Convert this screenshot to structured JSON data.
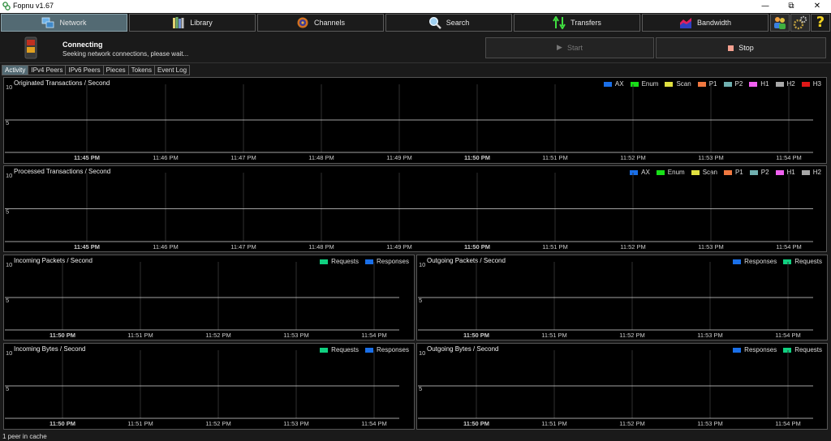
{
  "window": {
    "title": "Fopnu v1.67"
  },
  "tabs": [
    {
      "label": "Network",
      "icon": "network-icon"
    },
    {
      "label": "Library",
      "icon": "library-books-icon"
    },
    {
      "label": "Channels",
      "icon": "channels-icon"
    },
    {
      "label": "Search",
      "icon": "search-icon"
    },
    {
      "label": "Transfers",
      "icon": "transfers-icon"
    },
    {
      "label": "Bandwidth",
      "icon": "bandwidth-icon"
    }
  ],
  "status": {
    "title": "Connecting",
    "message": "Seeking network connections, please wait...",
    "start_label": "Start",
    "stop_label": "Stop"
  },
  "subtabs": [
    "Activity",
    "IPv4 Peers",
    "IPv6 Peers",
    "Pieces",
    "Tokens",
    "Event Log"
  ],
  "colors": {
    "AX": "#1a6fe8",
    "Enum": "#18e018",
    "Scan": "#e0e040",
    "P1": "#f07840",
    "P2": "#70b0b0",
    "H1": "#f060f0",
    "H2": "#a8a8a8",
    "H3": "#e01818",
    "Requests": "#10d080",
    "Responses": "#1a6fe8"
  },
  "charts": [
    {
      "title": "Originated Transactions / Second",
      "legend": [
        "AX",
        "Enum",
        "Scan",
        "P1",
        "P2",
        "H1",
        "H2",
        "H3"
      ],
      "y_ticks": [
        "10",
        "5"
      ],
      "x_ticks": [
        "11:45 PM",
        "11:46 PM",
        "11:47 PM",
        "11:48 PM",
        "11:49 PM",
        "11:50 PM",
        "11:51 PM",
        "11:52 PM",
        "11:53 PM",
        "11:54 PM"
      ]
    },
    {
      "title": "Processed Transactions / Second",
      "legend": [
        "AX",
        "Enum",
        "Scan",
        "P1",
        "P2",
        "H1",
        "H2"
      ],
      "y_ticks": [
        "10",
        "5"
      ],
      "x_ticks": [
        "11:45 PM",
        "11:46 PM",
        "11:47 PM",
        "11:48 PM",
        "11:49 PM",
        "11:50 PM",
        "11:51 PM",
        "11:52 PM",
        "11:53 PM",
        "11:54 PM"
      ]
    },
    {
      "title": "Incoming Packets / Second",
      "legend": [
        "Requests",
        "Responses"
      ],
      "y_ticks": [
        "10",
        "5"
      ],
      "x_ticks": [
        "11:50 PM",
        "11:51 PM",
        "11:52 PM",
        "11:53 PM",
        "11:54 PM"
      ]
    },
    {
      "title": "Outgoing Packets / Second",
      "legend": [
        "Responses",
        "Requests"
      ],
      "y_ticks": [
        "10",
        "5"
      ],
      "x_ticks": [
        "11:50 PM",
        "11:51 PM",
        "11:52 PM",
        "11:53 PM",
        "11:54 PM"
      ]
    },
    {
      "title": "Incoming Bytes / Second",
      "legend": [
        "Requests",
        "Responses"
      ],
      "y_ticks": [
        "10",
        "5"
      ],
      "x_ticks": [
        "11:50 PM",
        "11:51 PM",
        "11:52 PM",
        "11:53 PM",
        "11:54 PM"
      ]
    },
    {
      "title": "Outgoing Bytes / Second",
      "legend": [
        "Responses",
        "Requests"
      ],
      "y_ticks": [
        "10",
        "5"
      ],
      "x_ticks": [
        "11:50 PM",
        "11:51 PM",
        "11:52 PM",
        "11:53 PM",
        "11:54 PM"
      ]
    }
  ],
  "footer": {
    "text": "1 peer in cache"
  }
}
